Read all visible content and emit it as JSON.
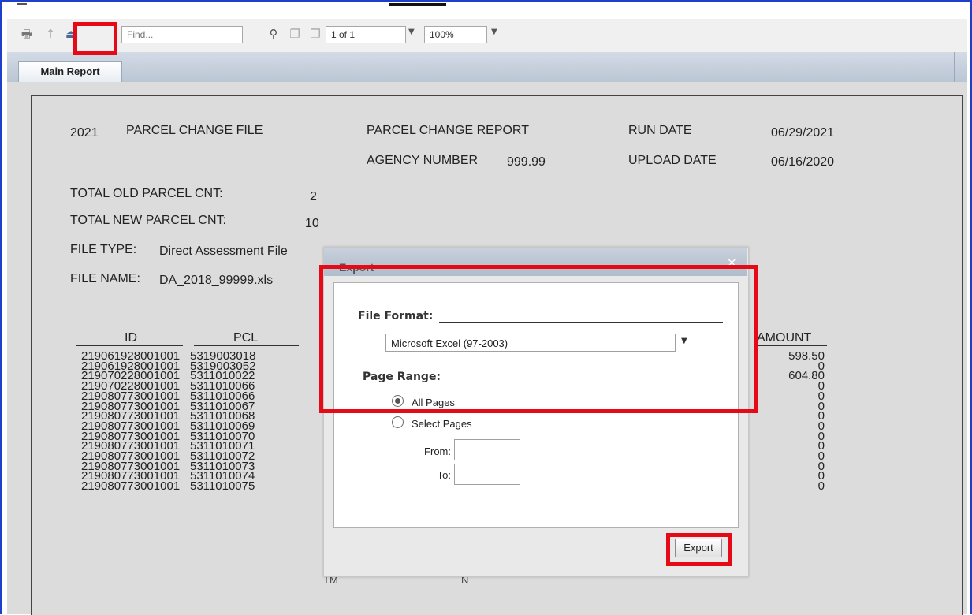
{
  "toolbar": {
    "find_placeholder": "Find...",
    "page_value": "1 of 1",
    "zoom_value": "100%"
  },
  "tabs": [
    {
      "label": "Main Report"
    }
  ],
  "report": {
    "header": {
      "year": "2021",
      "file_title": "PARCEL CHANGE FILE",
      "report_title": "PARCEL CHANGE REPORT",
      "run_date_label": "RUN DATE",
      "run_date": "06/29/2021",
      "agency_label": "AGENCY NUMBER",
      "agency_number": "999.99",
      "upload_date_label": "UPLOAD DATE",
      "upload_date": "06/16/2020"
    },
    "summary": {
      "old_cnt_label": "TOTAL OLD PARCEL CNT:",
      "old_cnt": "2",
      "new_cnt_label": "TOTAL NEW PARCEL CNT:",
      "new_cnt": "10",
      "file_type_label": "FILE TYPE:",
      "file_type": "Direct Assessment File",
      "file_name_label": "FILE NAME:",
      "file_name": "DA_2018_99999.xls"
    },
    "columns": {
      "id": "ID",
      "pcl": "PCL",
      "amount": "AMOUNT"
    },
    "rows": [
      {
        "id": "219061928001001",
        "pcl": "5319003018",
        "amount": "598.50"
      },
      {
        "id": "219061928001001",
        "pcl": "5319003052",
        "amount": "0"
      },
      {
        "id": "219070228001001",
        "pcl": "5311010022",
        "amount": "604.80"
      },
      {
        "id": "219070228001001",
        "pcl": "5311010066",
        "amount": "0"
      },
      {
        "id": "219080773001001",
        "pcl": "5311010066",
        "amount": "0"
      },
      {
        "id": "219080773001001",
        "pcl": "5311010067",
        "amount": "0"
      },
      {
        "id": "219080773001001",
        "pcl": "5311010068",
        "amount": "0"
      },
      {
        "id": "219080773001001",
        "pcl": "5311010069",
        "amount": "0"
      },
      {
        "id": "219080773001001",
        "pcl": "5311010070",
        "amount": "0"
      },
      {
        "id": "219080773001001",
        "pcl": "5311010071",
        "amount": "0"
      },
      {
        "id": "219080773001001",
        "pcl": "5311010072",
        "amount": "0"
      },
      {
        "id": "219080773001001",
        "pcl": "5311010073",
        "amount": "0"
      },
      {
        "id": "219080773001001",
        "pcl": "5311010074",
        "amount": "0"
      },
      {
        "id": "219080773001001",
        "pcl": "5311010075",
        "amount": "0"
      }
    ],
    "partial_cells": {
      "col3": "TM",
      "col4": "N"
    }
  },
  "dialog": {
    "title": "Export",
    "close_symbol": "×",
    "file_format_label": "File Format:",
    "file_format_value": "Microsoft Excel (97-2003)",
    "page_range_label": "Page Range:",
    "all_pages_label": "All Pages",
    "select_pages_label": "Select Pages",
    "from_label": "From:",
    "to_label": "To:",
    "export_button": "Export"
  },
  "icons": {
    "print": "print-icon",
    "export": "export-icon",
    "binoculars": "find-icon",
    "page_nav": "page-nav-icons"
  },
  "colors": {
    "highlight": "#e50a15",
    "frame": "#1e3fcc"
  }
}
